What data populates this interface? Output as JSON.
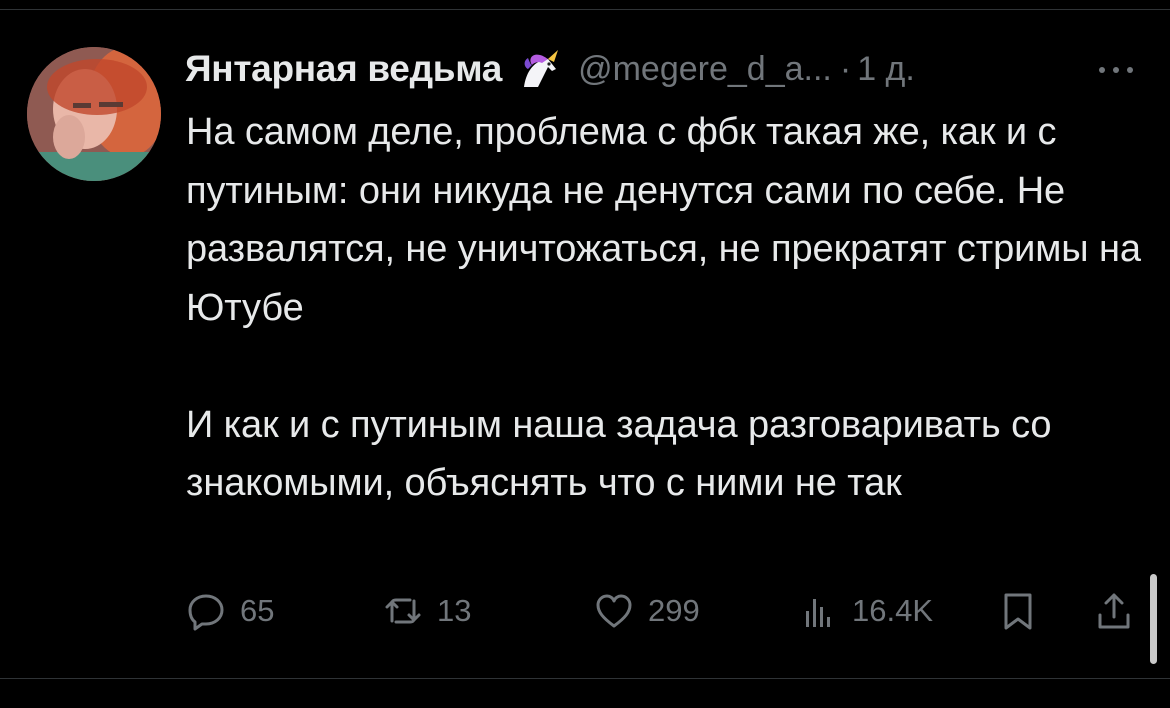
{
  "author": {
    "display_name": "Янтарная ведьма",
    "badge_icon": "unicorn-emoji-icon",
    "handle": "@megere_d_a...",
    "separator": "·",
    "time": "1 д."
  },
  "tweet": {
    "text": "На самом деле, проблема с фбк такая же, как и с путиным: они никуда не денутся сами по себе. Не развалятся, не уничтожаться, не прекратят стримы на Ютубе\n\nИ как и с путиным наша задача разговаривать со знакомыми, объяснять что с ними не так"
  },
  "actions": {
    "reply": {
      "icon": "reply-icon",
      "count": "65"
    },
    "retweet": {
      "icon": "retweet-icon",
      "count": "13"
    },
    "like": {
      "icon": "heart-icon",
      "count": "299"
    },
    "views": {
      "icon": "views-icon",
      "count": "16.4K"
    },
    "bookmark": {
      "icon": "bookmark-icon"
    },
    "share": {
      "icon": "share-icon"
    }
  },
  "colors": {
    "background": "#000000",
    "text": "#e7e9ea",
    "secondary": "#71767b",
    "divider": "#2f3336"
  }
}
